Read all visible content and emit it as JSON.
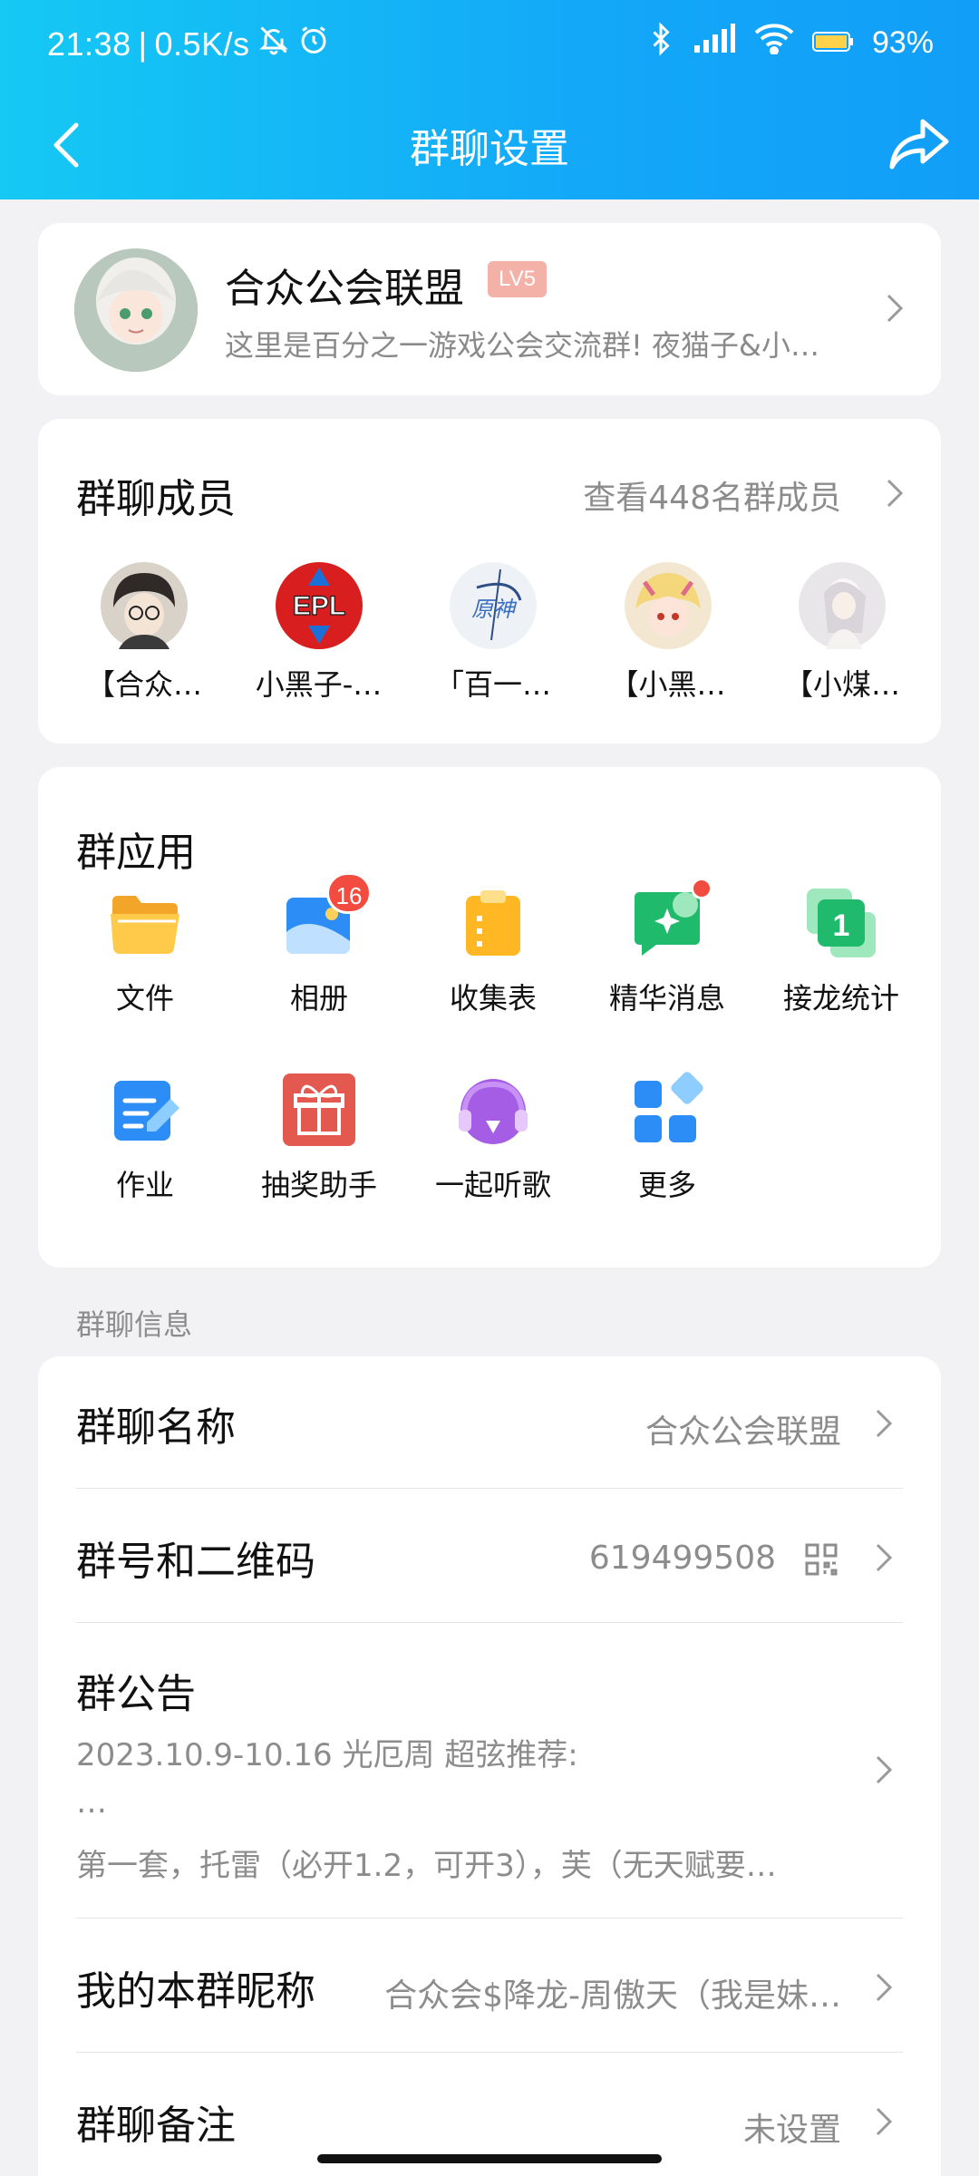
{
  "status_bar": {
    "time": "21:38",
    "net_speed": "0.5K/s",
    "battery": "93%",
    "icons": [
      "bell-off-icon",
      "alarm-icon",
      "bluetooth-icon",
      "signal-icon",
      "wifi-icon",
      "battery-icon"
    ]
  },
  "nav": {
    "title": "群聊设置",
    "back_icon": "back-arrow-icon",
    "share_icon": "share-icon"
  },
  "group": {
    "name": "合众公会联盟",
    "level": "LV5",
    "description": "这里是百分之一游戏公会交流群! 夜猫子&小…"
  },
  "members": {
    "title": "群聊成员",
    "view_all": "查看448名群成员",
    "items": [
      {
        "name": "【合众…"
      },
      {
        "name": "小黑子-…"
      },
      {
        "name": "「百一…"
      },
      {
        "name": "【小黑…"
      },
      {
        "name": "【小煤…"
      }
    ],
    "avatar_marks": [
      "",
      "EPL",
      "原神",
      "",
      ""
    ]
  },
  "apps": {
    "title": "群应用",
    "items": [
      {
        "label": "文件",
        "icon": "folder-icon"
      },
      {
        "label": "相册",
        "icon": "album-icon",
        "badge": "16"
      },
      {
        "label": "收集表",
        "icon": "clipboard-icon"
      },
      {
        "label": "精华消息",
        "icon": "essence-message-icon",
        "dot": true
      },
      {
        "label": "接龙统计",
        "icon": "relay-count-icon"
      },
      {
        "label": "作业",
        "icon": "homework-icon"
      },
      {
        "label": "抽奖助手",
        "icon": "gift-icon"
      },
      {
        "label": "一起听歌",
        "icon": "headphones-icon"
      },
      {
        "label": "更多",
        "icon": "more-apps-icon"
      }
    ]
  },
  "info": {
    "section_label": "群聊信息",
    "group_name_label": "群聊名称",
    "group_name_value": "合众公会联盟",
    "group_id_label": "群号和二维码",
    "group_id_value": "619499508",
    "notice_label": "群公告",
    "notice_line1": "2023.10.9-10.16 光厄周 超弦推荐:",
    "notice_line2": "…",
    "notice_line3": "第一套，托雷（必开1.2，可开3），芙（无天赋要…",
    "nickname_label": "我的本群昵称",
    "nickname_value": "合众会$降龙-周傲天（我是妹…",
    "remark_label": "群聊备注",
    "remark_value": "未设置"
  },
  "colors": {
    "header_start": "#15c9f4",
    "header_end": "#119ef8",
    "badge_red": "#f24b3f",
    "level_badge": "#f4b1a8"
  }
}
